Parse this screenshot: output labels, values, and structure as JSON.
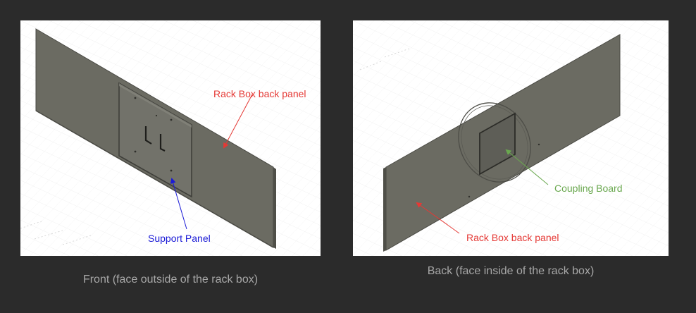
{
  "front": {
    "caption": "Front (face outside of the rack box)",
    "labels": {
      "rack_box_back_panel": "Rack Box back panel",
      "support_panel": "Support Panel"
    },
    "colors": {
      "rack_label": "#e53935",
      "support_label": "#1a1ad6"
    }
  },
  "back": {
    "caption": "Back (face inside of the rack box)",
    "labels": {
      "coupling_board": "Coupling Board",
      "rack_box_back_panel": "Rack Box back panel"
    },
    "colors": {
      "coupling_label": "#6aa84f",
      "rack_label": "#e53935"
    }
  }
}
